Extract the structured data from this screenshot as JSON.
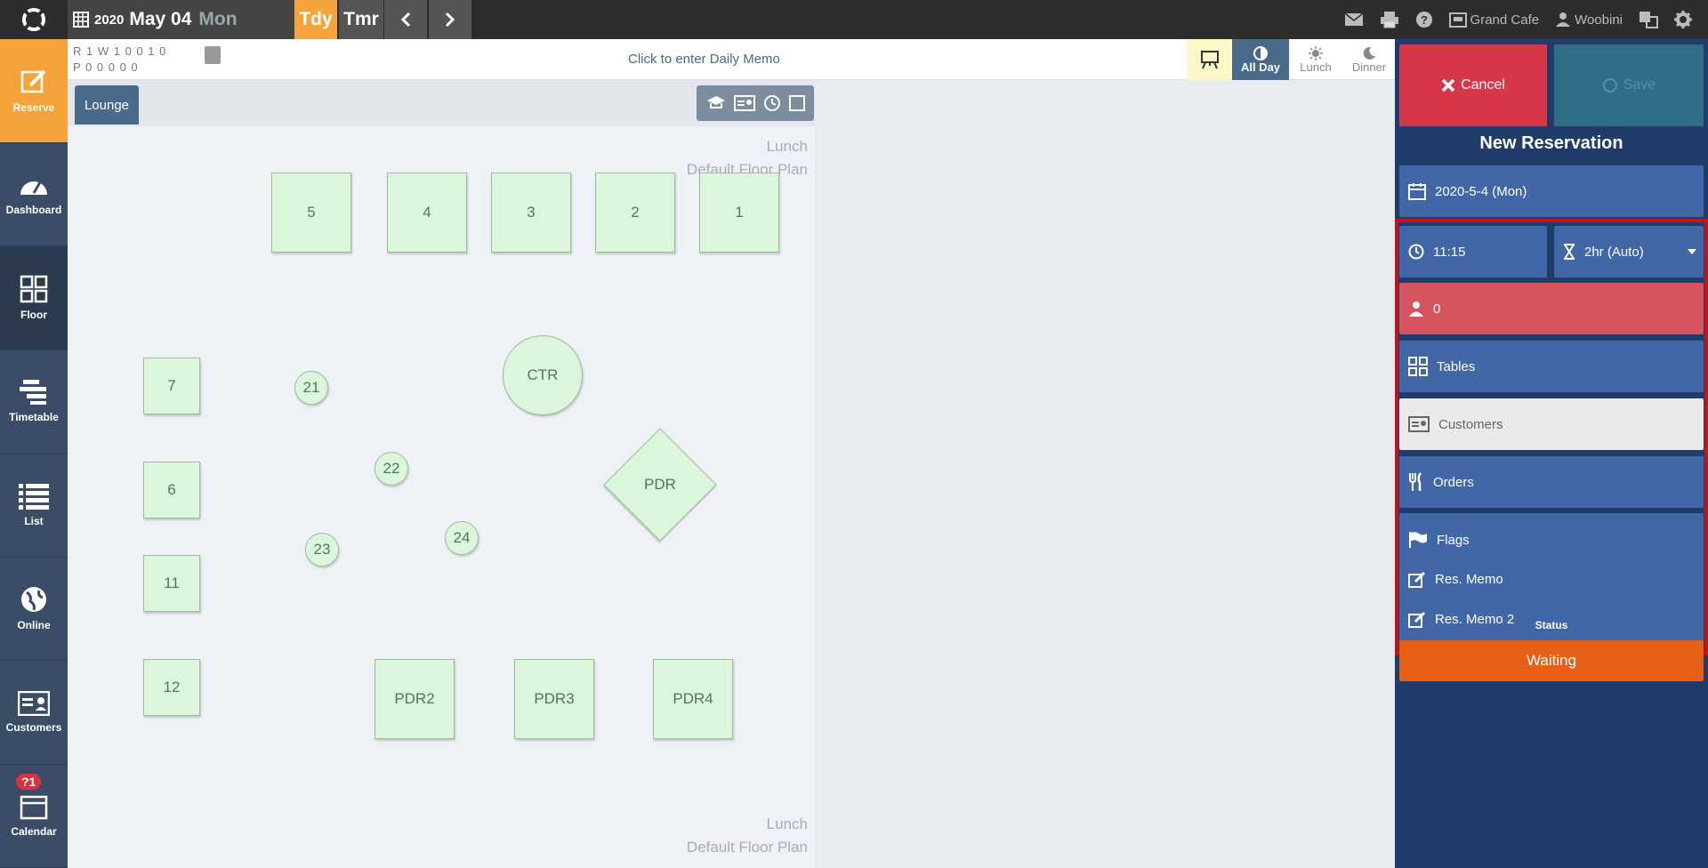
{
  "topbar": {
    "year": "2020",
    "month_day": "May 04",
    "dow": "Mon",
    "today_label": "Tdy",
    "tomorrow_label": "Tmr",
    "restaurant": "Grand Cafe",
    "user": "Woobini"
  },
  "sidebar": {
    "items": [
      {
        "label": "Reserve",
        "icon": "reserve-icon"
      },
      {
        "label": "Dashboard",
        "icon": "dashboard-icon"
      },
      {
        "label": "Floor",
        "icon": "floor-icon"
      },
      {
        "label": "Timetable",
        "icon": "timetable-icon"
      },
      {
        "label": "List",
        "icon": "list-icon"
      },
      {
        "label": "Online",
        "icon": "online-icon"
      },
      {
        "label": "Customers",
        "icon": "customers-icon"
      },
      {
        "label": "Calendar",
        "icon": "calendar-icon"
      }
    ],
    "calendar_badge": "?1"
  },
  "infobar": {
    "counts_r": "R 1 W 1 0 0 1 0",
    "counts_p": "P 0  0  0  0  0",
    "memo_count": "0",
    "daily_memo": "Click to enter Daily Memo",
    "shifts": [
      "All Day",
      "Lunch",
      "Dinner"
    ]
  },
  "floor": {
    "tab": "Lounge",
    "plan_shift": "Lunch",
    "plan_name": "Default Floor Plan",
    "tables": [
      "5",
      "4",
      "3",
      "2",
      "1",
      "7",
      "6",
      "11",
      "12",
      "21",
      "22",
      "23",
      "24",
      "CTR",
      "PDR",
      "PDR2",
      "PDR3",
      "PDR4"
    ]
  },
  "reservation": {
    "cancel_label": "Cancel",
    "save_label": "Save",
    "title": "New Reservation",
    "date": "2020-5-4 (Mon)",
    "time": "11:15",
    "duration": "2hr (Auto)",
    "guests": "0",
    "tables_label": "Tables",
    "customers_label": "Customers",
    "orders_label": "Orders",
    "flags_label": "Flags",
    "memo_label": "Res. Memo",
    "memo2_label": "Res. Memo 2",
    "status_label": "Status",
    "status_value": "Waiting"
  },
  "colors": {
    "accent_orange": "#f5a33b",
    "panel_blue": "#1f3c6b",
    "row_blue": "#4267a7",
    "cancel_red": "#d8374a",
    "status_orange": "#e85f16",
    "table_green": "#dcf6dc"
  }
}
